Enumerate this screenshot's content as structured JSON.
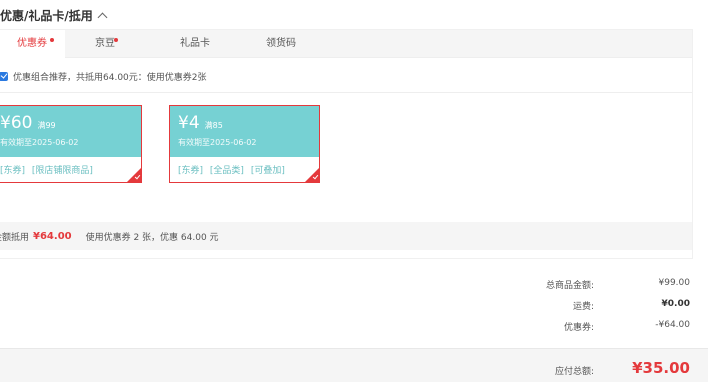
{
  "section": {
    "title": "优惠/礼品卡/抵用"
  },
  "tabs": [
    {
      "label": "优惠券",
      "active": true,
      "dot": true
    },
    {
      "label": "京豆",
      "active": false,
      "dot": true
    },
    {
      "label": "礼品卡",
      "active": false,
      "dot": false
    },
    {
      "label": "领货码",
      "active": false,
      "dot": false
    }
  ],
  "recommend": {
    "text": "优惠组合推荐，共抵用64.00元：使用优惠券2张",
    "checked": true
  },
  "coupons": [
    {
      "amount": "¥60",
      "threshold": "满99",
      "validity": "有效期至2025-06-02",
      "tags": [
        "[东券]",
        "[限店铺限商品]"
      ],
      "selected": true
    },
    {
      "amount": "¥4",
      "threshold": "满85",
      "validity": "有效期至2025-06-02",
      "tags": [
        "[东券]",
        "[全品类]",
        "[可叠加]"
      ],
      "selected": true
    }
  ],
  "summary": {
    "label": "金额抵用",
    "amount": "¥64.00",
    "detail": "使用优惠券 2 张，优惠 64.00 元"
  },
  "totals": [
    {
      "label": "总商品金额:",
      "value": "¥99.00"
    },
    {
      "label": "运费:",
      "value": "¥0.00"
    },
    {
      "label": "优惠券:",
      "value": "-¥64.00"
    }
  ],
  "payable": {
    "label": "应付总额:",
    "value": "¥35.00"
  },
  "colors": {
    "accent": "#e4393c",
    "coupon_bg": "#76d1d3",
    "checkbox": "#2a79e0"
  }
}
